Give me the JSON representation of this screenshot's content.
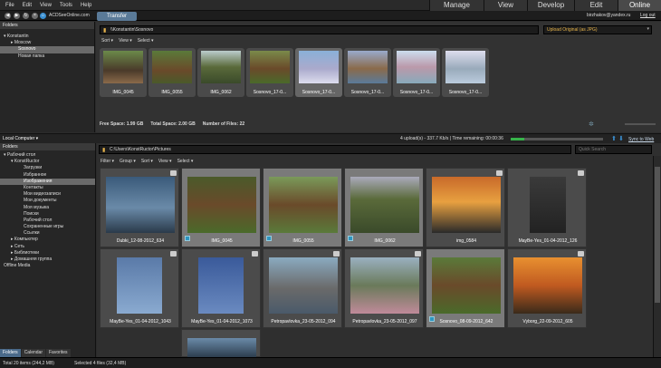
{
  "menu": [
    "File",
    "Edit",
    "View",
    "Tools",
    "Help"
  ],
  "modes": [
    "Manage",
    "View",
    "Develop",
    "Edit",
    "Online"
  ],
  "nav": {
    "site": "ACDSeeOnline.com",
    "transfer_tab": "Transfer",
    "user": "birzhakov@yandex.ru",
    "logout": "Log out"
  },
  "top_folders": {
    "title": "Folders",
    "items": [
      "Konstantin",
      "Moscow",
      "Sosnovo",
      "Новая папка"
    ]
  },
  "upload": {
    "path": "\\\\Konstantin\\Sosnovo",
    "option": "Upload Original (as JPG)",
    "toolbar": [
      "Sort",
      "View",
      "Select"
    ],
    "thumbs": [
      "IMG_0045",
      "IMG_0055",
      "IMG_0062",
      "Sosnovo_17-0...",
      "Sosnovo_17-0...",
      "Sosnovo_17-0...",
      "Sosnovo_17-0...",
      "Sosnovo_17-0..."
    ],
    "status": {
      "free": "Free Space: 1.99 GB",
      "total": "Total Space: 2.00 GB",
      "count": "Number of Files: 22"
    }
  },
  "progress": {
    "text": "4 upload(s) - 337.7 Kb/s | Time remaining: 00:00:36",
    "sync": "Sync to Web",
    "fraction": 0.15
  },
  "local": {
    "title": "Local Computer",
    "folders_label": "Folders",
    "tree": [
      "Рабочий стол",
      "KonstRuctor",
      "Загрузки",
      "Избранное",
      "Изображения",
      "Контакты",
      "Мои видеозаписи",
      "Мои документы",
      "Моя музыка",
      "Поиски",
      "Рабочий стол",
      "Сохраненные игры",
      "Ссылки",
      "Компьютер",
      "Сеть",
      "Библиотеки",
      "Домашняя группа",
      "Offline Media"
    ],
    "tabs": [
      "Folders",
      "Calendar",
      "Favorites"
    ]
  },
  "browser": {
    "path": "C:\\Users\\KonstRuctor\\Pictures",
    "search_placeholder": "Quick Search",
    "toolbar": [
      "Filter",
      "Group",
      "Sort",
      "View",
      "Select"
    ],
    "files": [
      "Dubki_12-08-2012_634",
      "IMG_0045",
      "IMG_0055",
      "IMG_0062",
      "img_0584",
      "MayBe-Yes_01-04-2012_126",
      "MayBe-Yes_01-04-2012_1043",
      "MayBe-Yes_01-04-2012_1073",
      "Petropavlovka_23-05-2012_094",
      "Petropavlovka_23-05-2012_097",
      "Sosnovo_08-09-2012_642",
      "Vyborg_22-09-2012_605"
    ]
  },
  "statusbar": {
    "total": "Total 20 items  (244,2 MB)",
    "selected": "Selected 4 files (32,4 MB)"
  }
}
